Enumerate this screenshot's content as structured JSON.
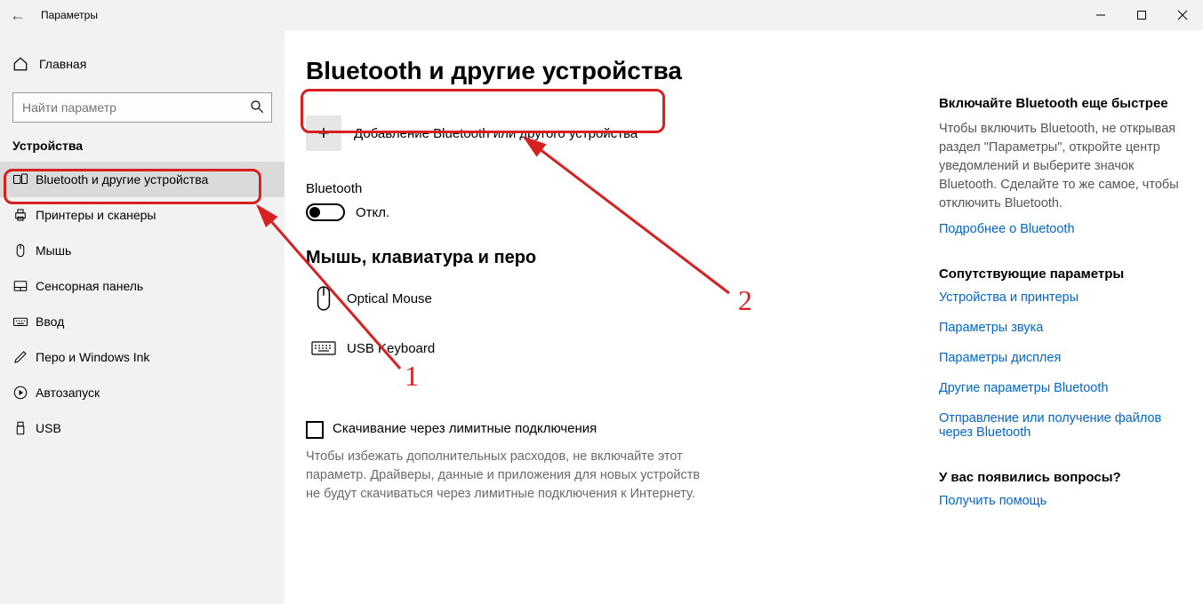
{
  "window": {
    "title": "Параметры"
  },
  "sidebar": {
    "home": "Главная",
    "search_placeholder": "Найти параметр",
    "category": "Устройства",
    "items": [
      {
        "label": "Bluetooth и другие устройства"
      },
      {
        "label": "Принтеры и сканеры"
      },
      {
        "label": "Мышь"
      },
      {
        "label": "Сенсорная панель"
      },
      {
        "label": "Ввод"
      },
      {
        "label": "Перо и Windows Ink"
      },
      {
        "label": "Автозапуск"
      },
      {
        "label": "USB"
      }
    ]
  },
  "main": {
    "heading": "Bluetooth и другие устройства",
    "add_label": "Добавление Bluetooth или другого устройства",
    "bt_label": "Bluetooth",
    "bt_state": "Откл.",
    "section_devices": "Мышь, клавиатура и перо",
    "devices": [
      {
        "name": "Optical Mouse"
      },
      {
        "name": "USB Keyboard"
      }
    ],
    "metered_label": "Скачивание через лимитные подключения",
    "metered_help": "Чтобы избежать дополнительных расходов, не включайте этот параметр. Драйверы, данные и приложения для новых устройств не будут скачиваться через лимитные подключения к Интернету."
  },
  "right": {
    "h1": "Включайте Bluetooth еще быстрее",
    "p1": "Чтобы включить Bluetooth, не открывая раздел \"Параметры\", откройте центр уведомлений и выберите значок Bluetooth. Сделайте то же самое, чтобы отключить Bluetooth.",
    "link1": "Подробнее о Bluetooth",
    "h2": "Сопутствующие параметры",
    "link2": "Устройства и принтеры",
    "link3": "Параметры звука",
    "link4": "Параметры дисплея",
    "link5": "Другие параметры Bluetooth",
    "link6": "Отправление или получение файлов через Bluetooth",
    "h3": "У вас появились вопросы?",
    "link7": "Получить помощь"
  },
  "anno": {
    "one": "1",
    "two": "2"
  }
}
